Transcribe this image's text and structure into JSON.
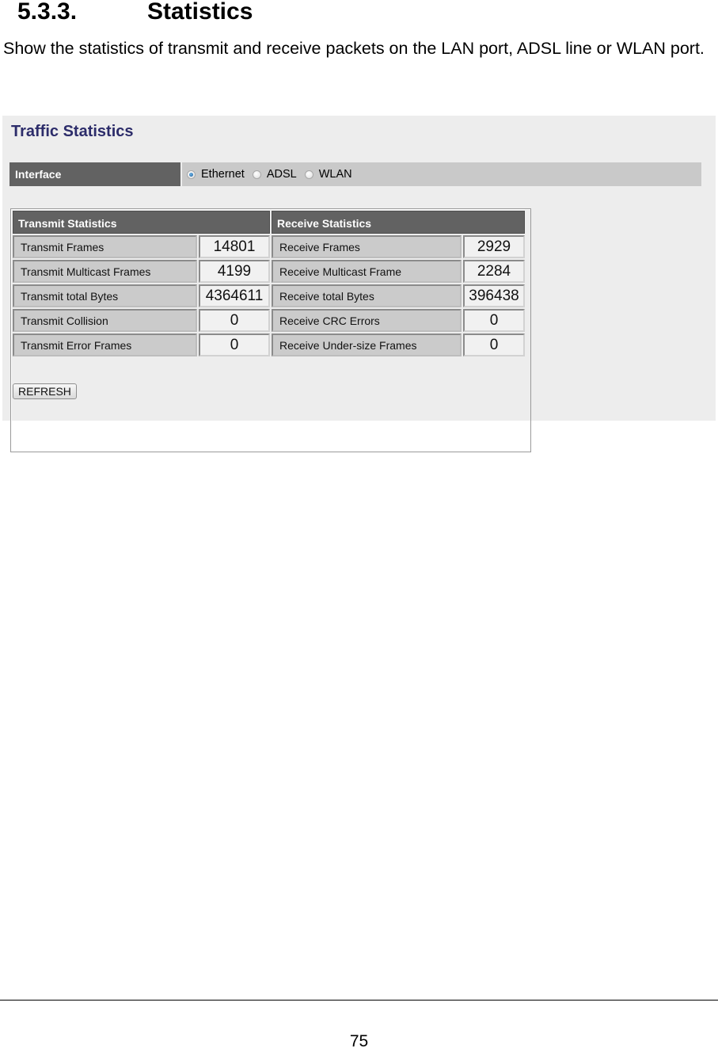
{
  "document": {
    "section_number": "5.3.3.",
    "section_title": "Statistics",
    "intro_text": "Show the statistics of transmit and receive packets on the LAN port, ADSL line or WLAN port.",
    "page_number": "75"
  },
  "panel": {
    "title": "Traffic Statistics",
    "interface": {
      "label": "Interface",
      "options": [
        {
          "label": "Ethernet",
          "checked": true
        },
        {
          "label": "ADSL",
          "checked": false
        },
        {
          "label": "WLAN",
          "checked": false
        }
      ]
    },
    "transmit": {
      "header": "Transmit Statistics",
      "rows": [
        {
          "label": "Transmit Frames",
          "value": "14801"
        },
        {
          "label": "Transmit Multicast Frames",
          "value": "4199"
        },
        {
          "label": "Transmit total Bytes",
          "value": "4364611"
        },
        {
          "label": "Transmit Collision",
          "value": "0"
        },
        {
          "label": "Transmit Error Frames",
          "value": "0"
        }
      ]
    },
    "receive": {
      "header": "Receive Statistics",
      "rows": [
        {
          "label": "Receive Frames",
          "value": "2929"
        },
        {
          "label": "Receive Multicast Frame",
          "value": "2284"
        },
        {
          "label": "Receive total Bytes",
          "value": "396438"
        },
        {
          "label": "Receive CRC Errors",
          "value": "0"
        },
        {
          "label": "Receive Under-size Frames",
          "value": "0"
        }
      ]
    },
    "refresh_label": "REFRESH"
  },
  "colors": {
    "panel_bg": "#ededed",
    "title_color": "#2c2c6a",
    "header_bg": "#626262",
    "label_bg": "#cbcbcb",
    "value_bg": "#f1f1f1",
    "radio_checked": "#1a5d9c"
  }
}
